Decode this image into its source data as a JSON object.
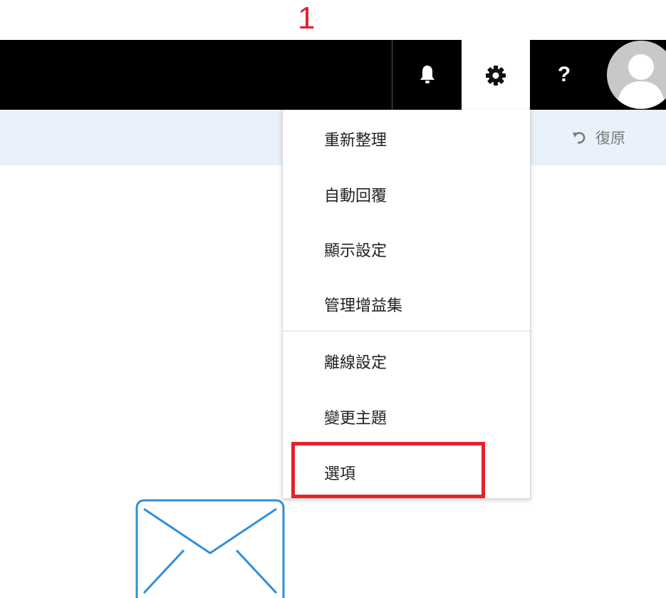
{
  "annotation": {
    "step_number": "1",
    "color": "#e8202a"
  },
  "topbar": {
    "background": "#000000",
    "icons": [
      "bell-icon",
      "gear-icon",
      "help-icon",
      "avatar"
    ],
    "help_label": "?"
  },
  "commandbar": {
    "undo_icon": "undo-icon",
    "undo_label": "復原"
  },
  "settings_menu": {
    "items": [
      {
        "label": "重新整理"
      },
      {
        "label": "自動回覆"
      },
      {
        "label": "顯示設定"
      },
      {
        "label": "管理增益集"
      },
      {
        "label": "離線設定"
      },
      {
        "label": "變更主題"
      },
      {
        "label": "選項"
      }
    ],
    "highlighted_item": "選項"
  },
  "illustration": {
    "icon": "mail-envelope-icon",
    "color": "#2f8fd8"
  }
}
